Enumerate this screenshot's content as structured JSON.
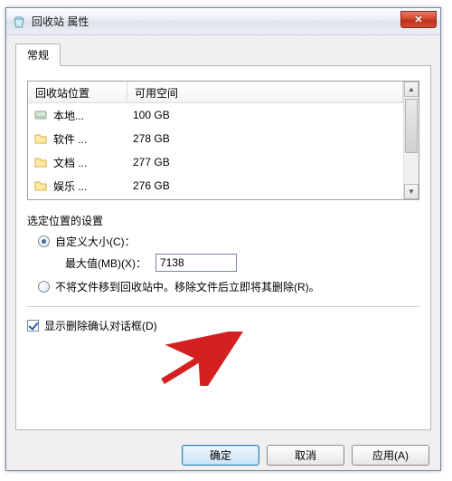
{
  "window": {
    "title": "回收站 属性"
  },
  "tab": {
    "general": "常规"
  },
  "list": {
    "headers": {
      "location": "回收站位置",
      "space": "可用空间"
    },
    "rows": [
      {
        "name": "本地...",
        "size": "100 GB",
        "icon": "disk"
      },
      {
        "name": "软件 ...",
        "size": "278 GB",
        "icon": "folder"
      },
      {
        "name": "文档 ...",
        "size": "277 GB",
        "icon": "folder"
      },
      {
        "name": "娱乐 ...",
        "size": "276 GB",
        "icon": "folder"
      }
    ]
  },
  "section": {
    "label": "选定位置的设置"
  },
  "radios": {
    "custom": "自定义大小(C)：",
    "max_label": "最大值(MB)(X)：",
    "max_value": "7138",
    "nomove": "不将文件移到回收站中。移除文件后立即将其删除(R)。"
  },
  "checkbox": {
    "confirm_delete": "显示删除确认对话框(D)"
  },
  "buttons": {
    "ok": "确定",
    "cancel": "取消",
    "apply": "应用(A)"
  },
  "close_glyph": "✕"
}
